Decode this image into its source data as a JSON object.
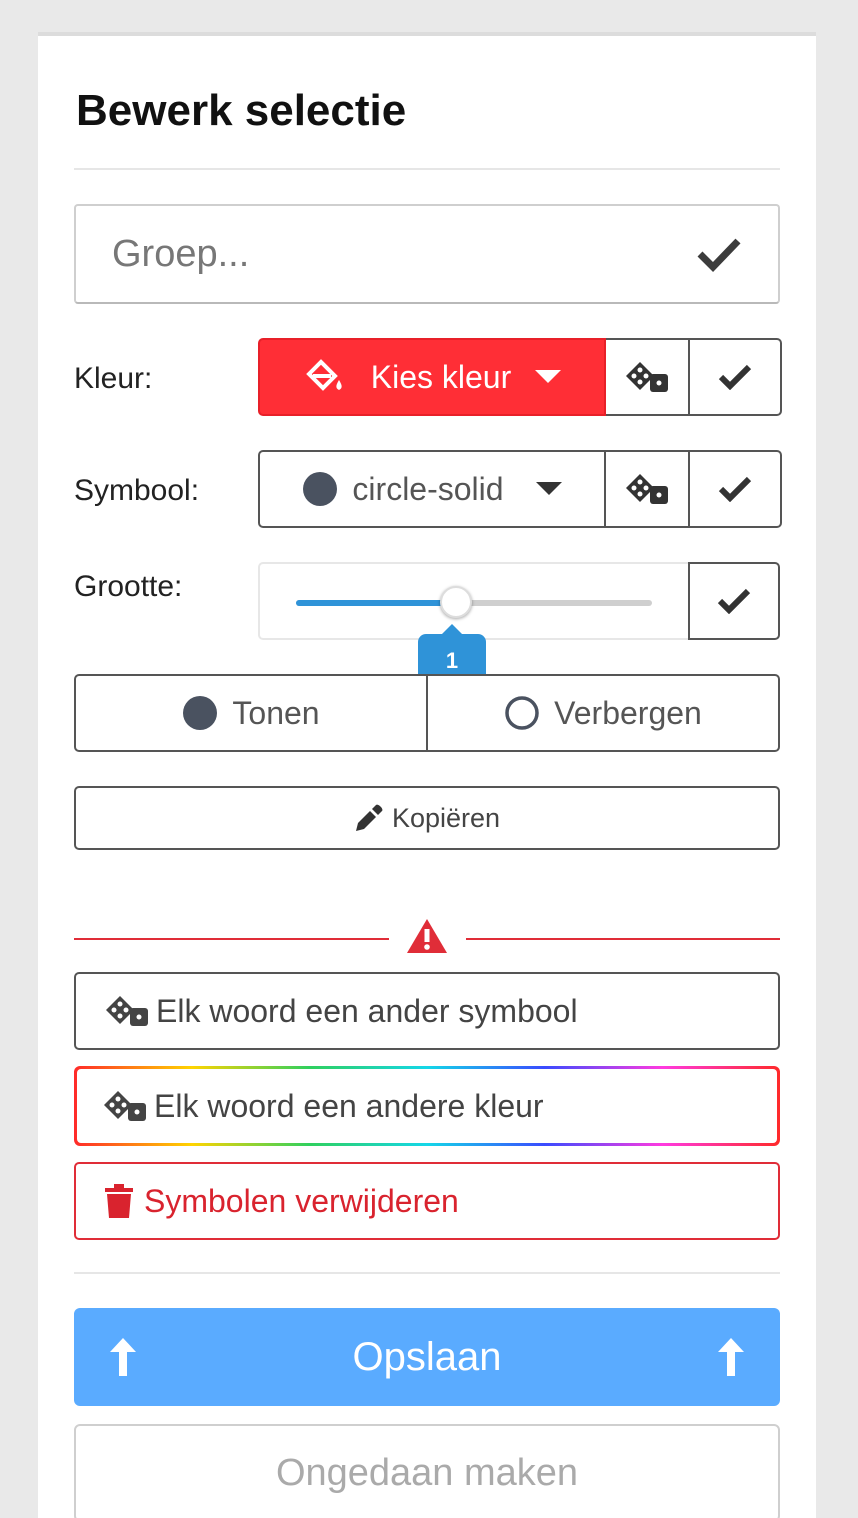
{
  "panel": {
    "title": "Bewerk selectie"
  },
  "group": {
    "placeholder": "Groep..."
  },
  "color_row": {
    "label": "Kleur:",
    "button_label": "Kies kleur",
    "accent": "#ff2e36"
  },
  "symbol_row": {
    "label": "Symbool:",
    "selected": "circle-solid"
  },
  "size_row": {
    "label": "Grootte:",
    "value": "1",
    "slider_fraction": 0.45
  },
  "visibility": {
    "show_label": "Tonen",
    "hide_label": "Verbergen"
  },
  "copy": {
    "label": "Kopiëren"
  },
  "danger": {
    "random_symbol_label": "Elk woord een ander symbool",
    "random_color_label": "Elk woord een andere kleur",
    "remove_label": "Symbolen verwijderen",
    "color": "#e02d38"
  },
  "actions": {
    "save_label": "Opslaan",
    "undo_label": "Ongedaan maken",
    "save_color": "#5aabff"
  },
  "icons": {
    "confirm": "check-icon",
    "fill": "paint-bucket-icon",
    "random": "dice-icon",
    "warning": "warning-triangle-icon",
    "trash": "trash-icon",
    "eyedropper": "eyedropper-icon",
    "upload": "arrow-up-icon"
  }
}
